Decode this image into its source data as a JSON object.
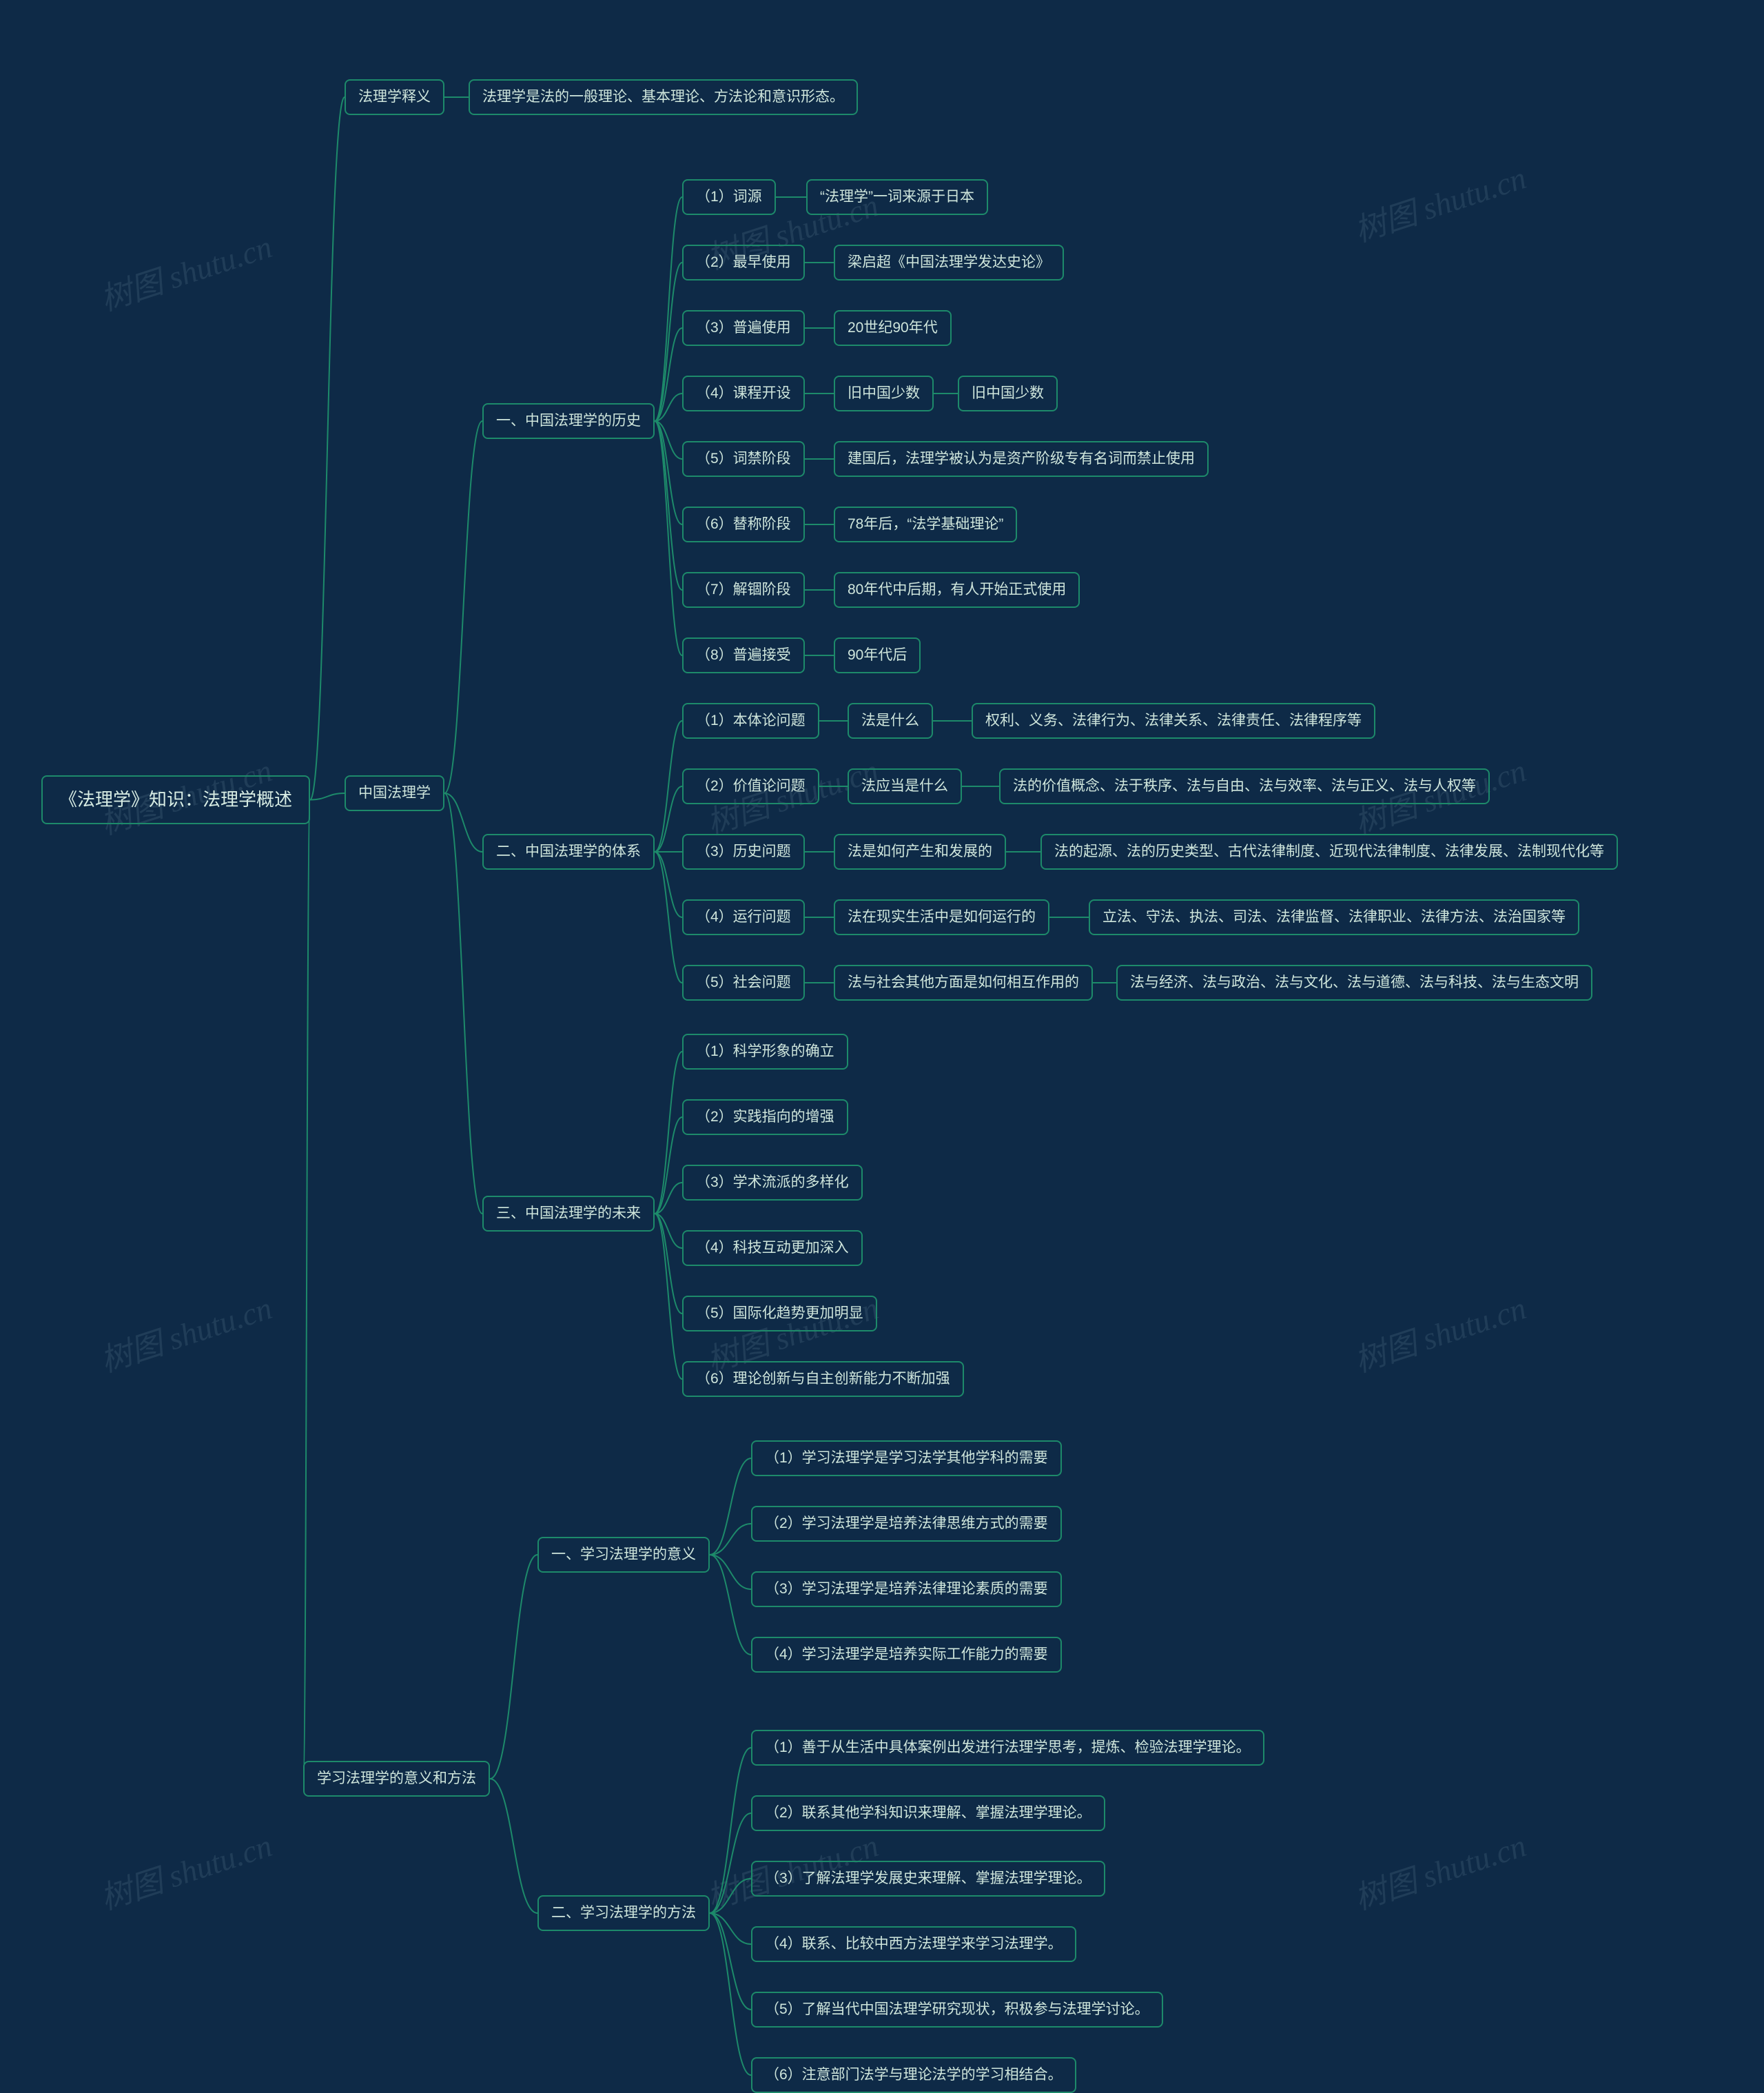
{
  "root": "《法理学》知识：法理学概述",
  "b1": {
    "title": "法理学释义",
    "c1": "法理学是法的一般理论、基本理论、方法论和意识形态。"
  },
  "b2": {
    "title": "中国法理学",
    "s1": {
      "title": "一、中国法理学的历史",
      "n1": {
        "a": "（1）词源",
        "b": "“法理学”一词来源于日本"
      },
      "n2": {
        "a": "（2）最早使用",
        "b": "梁启超《中国法理学发达史论》"
      },
      "n3": {
        "a": "（3）普遍使用",
        "b": "20世纪90年代"
      },
      "n4": {
        "a": "（4）课程开设",
        "b": "旧中国少数",
        "c": "旧中国少数"
      },
      "n5": {
        "a": "（5）词禁阶段",
        "b": "建国后，法理学被认为是资产阶级专有名词而禁止使用"
      },
      "n6": {
        "a": "（6）替称阶段",
        "b": "78年后，“法学基础理论”"
      },
      "n7": {
        "a": "（7）解锢阶段",
        "b": "80年代中后期，有人开始正式使用"
      },
      "n8": {
        "a": "（8）普遍接受",
        "b": "90年代后"
      }
    },
    "s2": {
      "title": "二、中国法理学的体系",
      "n1": {
        "a": "（1）本体论问题",
        "b": "法是什么",
        "c": "权利、义务、法律行为、法律关系、法律责任、法律程序等"
      },
      "n2": {
        "a": "（2）价值论问题",
        "b": "法应当是什么",
        "c": "法的价值概念、法于秩序、法与自由、法与效率、法与正义、法与人权等"
      },
      "n3": {
        "a": "（3）历史问题",
        "b": "法是如何产生和发展的",
        "c": "法的起源、法的历史类型、古代法律制度、近现代法律制度、法律发展、法制现代化等"
      },
      "n4": {
        "a": "（4）运行问题",
        "b": "法在现实生活中是如何运行的",
        "c": "立法、守法、执法、司法、法律监督、法律职业、法律方法、法治国家等"
      },
      "n5": {
        "a": "（5）社会问题",
        "b": "法与社会其他方面是如何相互作用的",
        "c": "法与经济、法与政治、法与文化、法与道德、法与科技、法与生态文明"
      }
    },
    "s3": {
      "title": "三、中国法理学的未来",
      "n1": "（1）科学形象的确立",
      "n2": "（2）实践指向的增强",
      "n3": "（3）学术流派的多样化",
      "n4": "（4）科技互动更加深入",
      "n5": "（5）国际化趋势更加明显",
      "n6": "（6）理论创新与自主创新能力不断加强"
    }
  },
  "b3": {
    "title": "学习法理学的意义和方法",
    "s1": {
      "title": "一、学习法理学的意义",
      "n1": "（1）学习法理学是学习法学其他学科的需要",
      "n2": "（2）学习法理学是培养法律思维方式的需要",
      "n3": "（3）学习法理学是培养法律理论素质的需要",
      "n4": "（4）学习法理学是培养实际工作能力的需要"
    },
    "s2": {
      "title": "二、学习法理学的方法",
      "n1": "（1）善于从生活中具体案例出发进行法理学思考，提炼、检验法理学理论。",
      "n2": "（2）联系其他学科知识来理解、掌握法理学理论。",
      "n3": "（3）了解法理学发展史来理解、掌握法理学理论。",
      "n4": "（4）联系、比较中西方法理学来学习法理学。",
      "n5": "（5）了解当代中国法理学研究现状，积极参与法理学讨论。",
      "n6": "（6）注意部门法学与理论法学的学习相结合。"
    }
  },
  "wm": "树图 shutu.cn"
}
